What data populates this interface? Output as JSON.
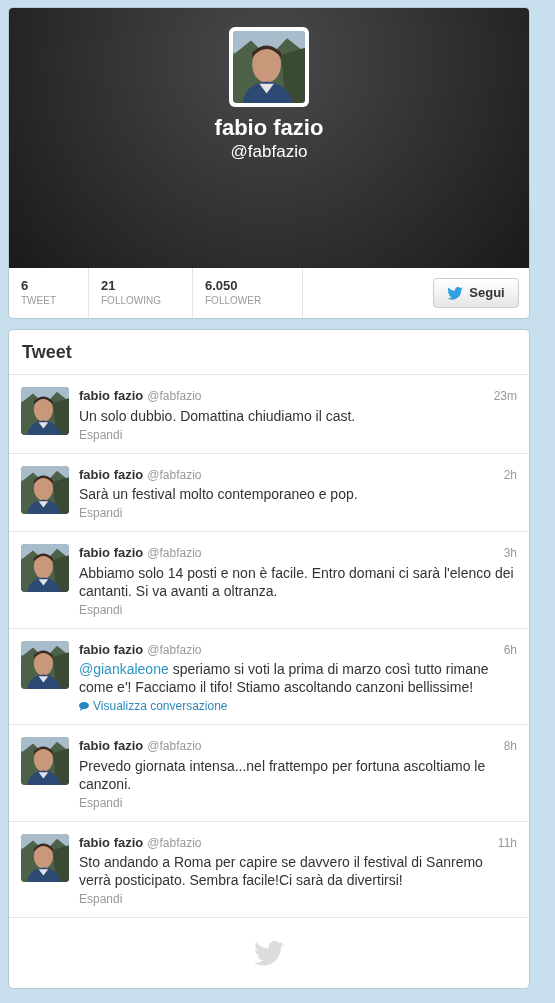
{
  "profile": {
    "name": "fabio fazio",
    "handle": "@fabfazio"
  },
  "stats": [
    {
      "value": "6",
      "label": "TWEET"
    },
    {
      "value": "21",
      "label": "FOLLOWING"
    },
    {
      "value": "6.050",
      "label": "FOLLOWER"
    }
  ],
  "follow_button": {
    "label": "Segui"
  },
  "tweets_panel": {
    "title": "Tweet",
    "tweets": [
      {
        "name": "fabio fazio",
        "handle": "@fabfazio",
        "time": "23m",
        "text": "Un solo dubbio. Domattina chiudiamo il cast.",
        "action": {
          "kind": "expand",
          "label": "Espandi"
        }
      },
      {
        "name": "fabio fazio",
        "handle": "@fabfazio",
        "time": "2h",
        "text": "Sarà un festival molto contemporaneo e pop.",
        "action": {
          "kind": "expand",
          "label": "Espandi"
        }
      },
      {
        "name": "fabio fazio",
        "handle": "@fabfazio",
        "time": "3h",
        "text": "Abbiamo solo 14 posti e non è facile. Entro domani ci sarà l'elenco dei cantanti. Si va avanti a oltranza.",
        "action": {
          "kind": "expand",
          "label": "Espandi"
        }
      },
      {
        "name": "fabio fazio",
        "handle": "@fabfazio",
        "time": "6h",
        "mention": "@giankaleone",
        "text": "speriamo si voti la prima di marzo così tutto rimane come e'! Facciamo il tifo! Stiamo ascoltando canzoni bellissime!",
        "action": {
          "kind": "conversation",
          "label": "Visualizza conversazione"
        }
      },
      {
        "name": "fabio fazio",
        "handle": "@fabfazio",
        "time": "8h",
        "text": "Prevedo giornata intensa...nel frattempo per fortuna ascoltiamo le canzoni.",
        "action": {
          "kind": "expand",
          "label": "Espandi"
        }
      },
      {
        "name": "fabio fazio",
        "handle": "@fabfazio",
        "time": "11h",
        "text": "Sto andando a Roma per capire se davvero il festival di Sanremo verrà posticipato. Sembra facile!Ci sarà da divertirsi!",
        "action": {
          "kind": "expand",
          "label": "Espandi"
        }
      }
    ]
  }
}
